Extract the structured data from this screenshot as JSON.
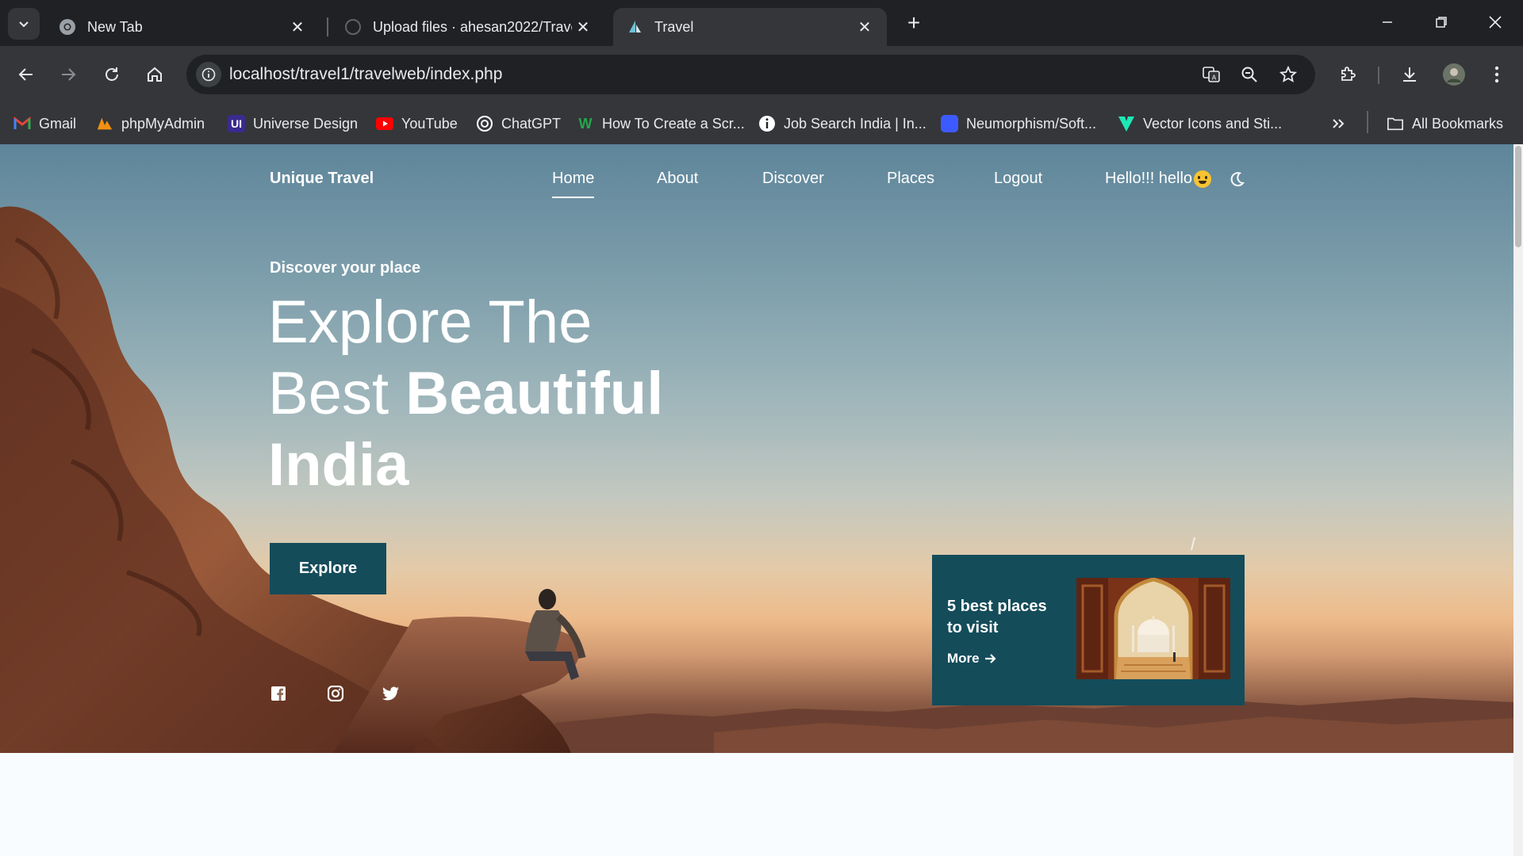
{
  "browser": {
    "tabs": [
      {
        "title": "New Tab",
        "icon": "chrome-icon",
        "active": false
      },
      {
        "title": "Upload files · ahesan2022/Trave",
        "icon": "github-icon",
        "active": false
      },
      {
        "title": "Travel",
        "icon": "travel-site-icon",
        "active": true
      }
    ],
    "url": "localhost/travel1/travelweb/index.php",
    "bookmarks": [
      {
        "label": "Gmail",
        "icon": "gmail-icon",
        "color": "#ea4335"
      },
      {
        "label": "phpMyAdmin",
        "icon": "phpmyadmin-icon",
        "color": "#f29111"
      },
      {
        "label": "Universe Design",
        "icon": "universe-design-icon",
        "color": "#3b2a8f"
      },
      {
        "label": "YouTube",
        "icon": "youtube-icon",
        "color": "#ff0000"
      },
      {
        "label": "ChatGPT",
        "icon": "chatgpt-icon",
        "color": "#ffffff"
      },
      {
        "label": "How To Create a Scr...",
        "icon": "w-icon",
        "color": "#22a84a"
      },
      {
        "label": "Job Search India | In...",
        "icon": "info-icon",
        "color": "#ffffff"
      },
      {
        "label": "Neumorphism/Soft...",
        "icon": "neumorphism-icon",
        "color": "#3d5afe"
      },
      {
        "label": "Vector Icons and Sti...",
        "icon": "vector-icons-icon",
        "color": "#1de9b6"
      }
    ],
    "all_bookmarks": "All Bookmarks"
  },
  "site": {
    "logo": "Unique Travel",
    "nav": [
      "Home",
      "About",
      "Discover",
      "Places",
      "Logout"
    ],
    "active_nav": "Home",
    "greeting": "Hello!!! hello",
    "hero": {
      "subtitle": "Discover your place",
      "headline_line1": "Explore The",
      "headline_line2_light": "Best ",
      "headline_line2_bold": "Beautiful",
      "headline_line3": "India",
      "button": "Explore"
    },
    "social_icons": [
      "facebook-icon",
      "instagram-icon",
      "twitter-icon"
    ],
    "card": {
      "title": "5 best places to visit",
      "link": "More"
    }
  },
  "colors": {
    "accent": "#144c5a",
    "chrome_dark": "#202124",
    "chrome_mid": "#35363a"
  }
}
